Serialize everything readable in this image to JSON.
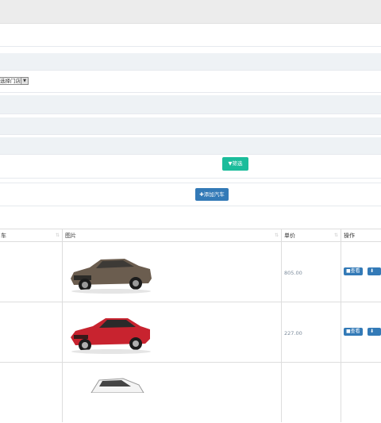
{
  "filters": {
    "store_select": "选择门店",
    "filter_button": "筛选",
    "filter_icon": "filter-icon"
  },
  "toolbar": {
    "add_button": "添加汽车",
    "add_icon": "plus-icon"
  },
  "table": {
    "columns": [
      "车",
      "图片",
      "单价",
      "操作"
    ],
    "rows": [
      {
        "image": "dark-bronze-sedan",
        "price": "805.00",
        "view": "查看",
        "extra": "提"
      },
      {
        "image": "red-sedan",
        "price": "227.00",
        "view": "查看",
        "extra": "提"
      },
      {
        "image": "white-suv"
      }
    ]
  },
  "colors": {
    "filter_button": "#1bbc9b",
    "add_button": "#337ab7",
    "header_band": "#ececec",
    "stripe": "#eef2f5"
  }
}
